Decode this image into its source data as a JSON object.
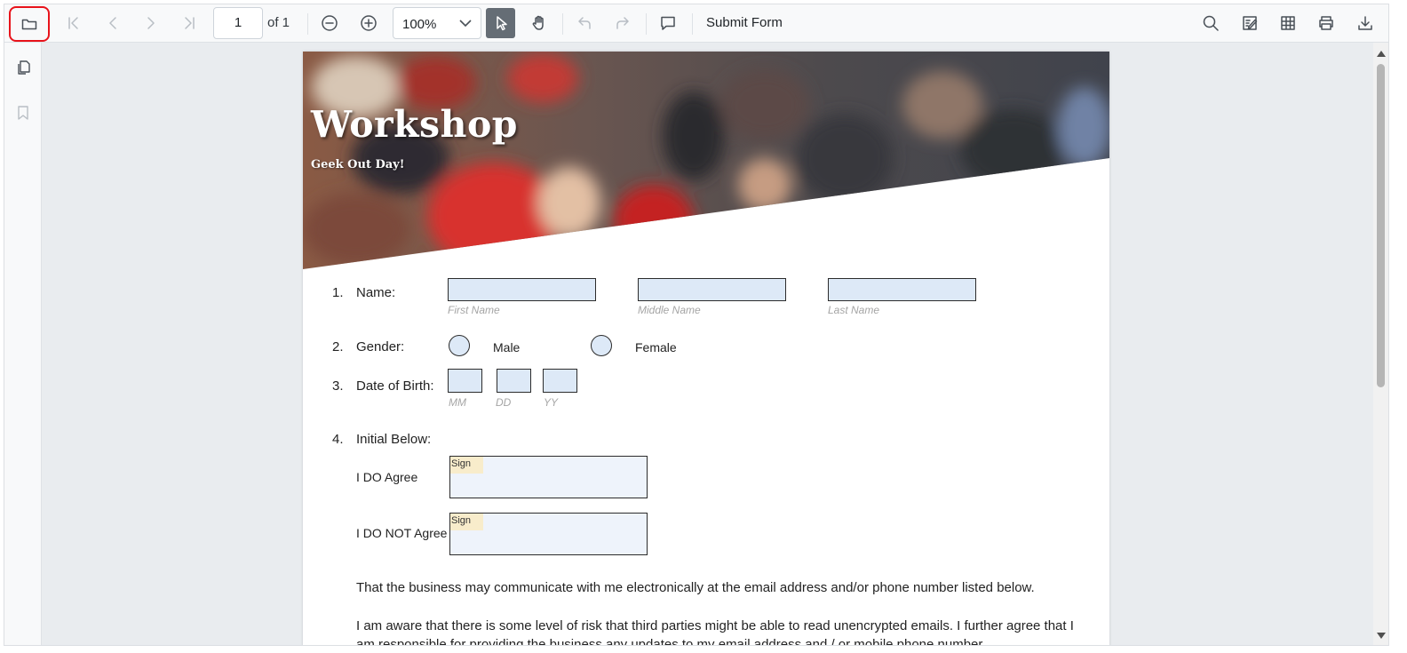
{
  "toolbar": {
    "page_number": "1",
    "page_of": "of 1",
    "zoom": "100%",
    "submit_label": "Submit Form"
  },
  "document": {
    "banner_title": "Workshop",
    "banner_subtitle": "Geek Out Day!",
    "items": [
      {
        "num": "1.",
        "label": "Name:"
      },
      {
        "num": "2.",
        "label": "Gender:"
      },
      {
        "num": "3.",
        "label": "Date of Birth:"
      },
      {
        "num": "4.",
        "label": "Initial Below:"
      }
    ],
    "name_hints": [
      "First Name",
      "Middle Name",
      "Last Name"
    ],
    "gender_options": [
      "Male",
      "Female"
    ],
    "dob_hints": [
      "MM",
      "DD",
      "YY"
    ],
    "initials": [
      {
        "label": "I DO Agree",
        "tag": "Sign"
      },
      {
        "label": "I DO NOT Agree",
        "tag": "Sign"
      }
    ],
    "paragraphs": [
      "That the business may communicate with me electronically at the email address and/or phone number listed below.",
      "I am aware that there is some level of risk that third parties might be able to read unencrypted emails. I further agree that I am responsible for providing the business any updates to my email address and / or mobile phone number."
    ]
  },
  "icons": {
    "toolbar_left": [
      "folder-open-icon",
      "first-page-icon",
      "previous-page-icon",
      "next-page-icon",
      "last-page-icon",
      "zoom-out-icon",
      "zoom-in-icon",
      "chevron-down-icon",
      "cursor-icon",
      "pan-hand-icon",
      "undo-icon",
      "redo-icon",
      "comment-icon"
    ],
    "toolbar_right": [
      "search-icon",
      "annotation-edit-icon",
      "form-designer-icon",
      "print-icon",
      "download-icon"
    ],
    "rail": [
      "page-thumbnails-icon",
      "bookmark-icon"
    ]
  },
  "colors": {
    "highlight_frame": "#e8131b",
    "form_field_fill": "#dde9f7",
    "active_tool": "#656d75",
    "sign_tag": "#f8eccb"
  }
}
